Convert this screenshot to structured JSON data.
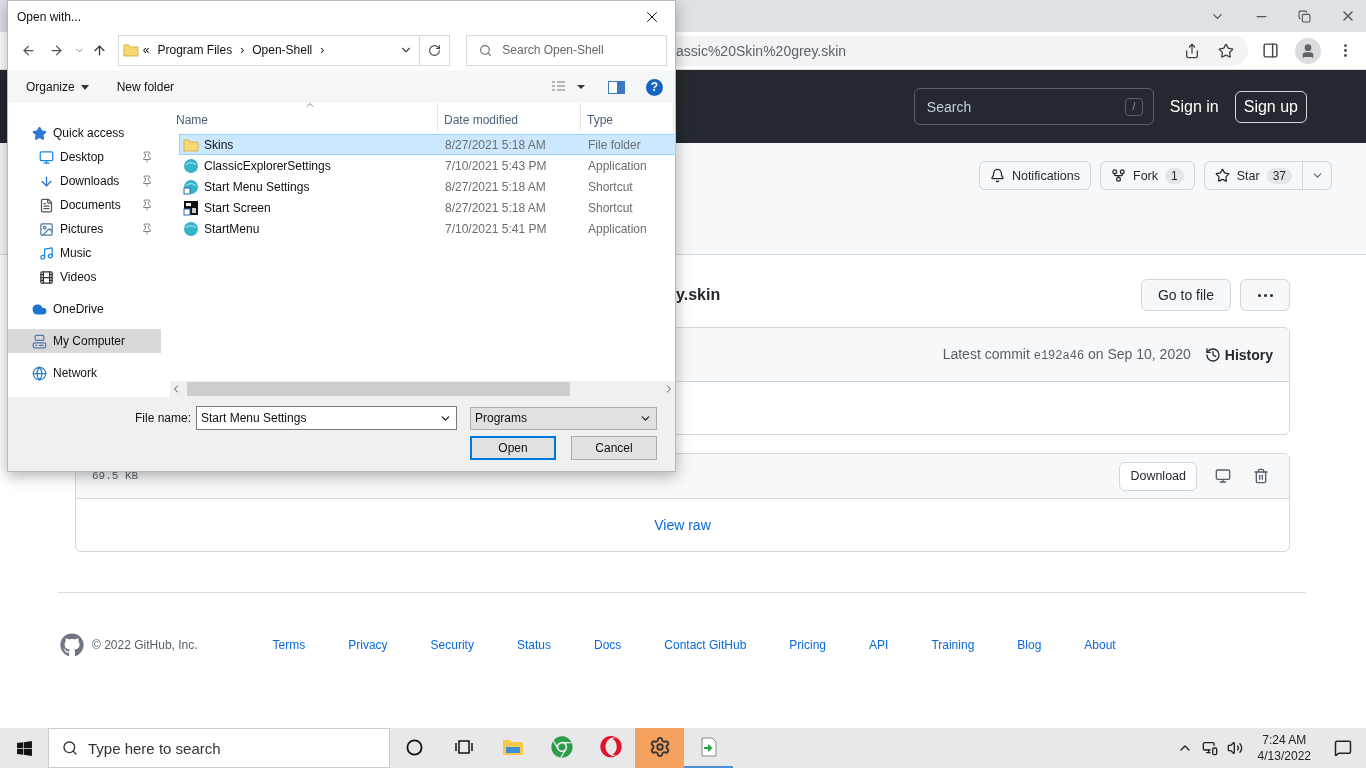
{
  "browser": {
    "url": "assic%20Skin%20grey.skin"
  },
  "github": {
    "search": {
      "placeholder": "Search",
      "shortcut": "/"
    },
    "sign_in": "Sign in",
    "sign_up": "Sign up",
    "repo_actions": [
      {
        "kind": "notifications",
        "label": "Notifications"
      },
      {
        "kind": "fork",
        "label": "Fork",
        "count": "1"
      },
      {
        "kind": "star",
        "label": "Star",
        "count": "37"
      }
    ],
    "file_title": "y.skin",
    "go_to_file": "Go to file",
    "commit": {
      "prefix": "Latest commit",
      "sha": "e192a46",
      "date": "on Sep 10, 2020"
    },
    "history": "History",
    "file_size": "69.5 KB",
    "download": "Download",
    "view_raw": "View raw",
    "footer": {
      "copyright": "© 2022 GitHub, Inc.",
      "links": [
        "Terms",
        "Privacy",
        "Security",
        "Status",
        "Docs",
        "Contact GitHub",
        "Pricing",
        "API",
        "Training",
        "Blog",
        "About"
      ]
    }
  },
  "dialog": {
    "title": "Open with...",
    "breadcrumbs": {
      "overflow": "«",
      "items": [
        {
          "label": "Program Files",
          "separator": "›"
        },
        {
          "label": "Open-Shell",
          "separator": "›"
        }
      ]
    },
    "search_placeholder": "Search Open-Shell",
    "help": "?",
    "commands": [
      {
        "label": "Organize",
        "menu": true
      },
      {
        "label": "New folder",
        "menu": false
      }
    ],
    "navigation": [
      {
        "label": "Quick access",
        "kind": "star",
        "selected": false,
        "pinned": false,
        "children": [
          {
            "label": "Desktop",
            "kind": "desktop",
            "selected": false,
            "pinned": true
          },
          {
            "label": "Downloads",
            "kind": "downloads",
            "selected": false,
            "pinned": true
          },
          {
            "label": "Documents",
            "kind": "documents",
            "selected": false,
            "pinned": true
          },
          {
            "label": "Pictures",
            "kind": "pictures",
            "selected": false,
            "pinned": true
          },
          {
            "label": "Music",
            "kind": "music",
            "selected": false,
            "pinned": false
          },
          {
            "label": "Videos",
            "kind": "videos",
            "selected": false,
            "pinned": false
          }
        ]
      },
      {
        "label": "OneDrive",
        "kind": "cloud",
        "selected": false,
        "pinned": false
      },
      {
        "label": "My Computer",
        "kind": "computer",
        "selected": true,
        "pinned": false
      },
      {
        "label": "Network",
        "kind": "network",
        "selected": false,
        "pinned": false
      }
    ],
    "columns": [
      {
        "label": "Name",
        "sorted": true
      },
      {
        "label": "Date modified",
        "sorted": false
      },
      {
        "label": "Type",
        "sorted": false
      }
    ],
    "files": [
      {
        "name": "Skins",
        "date": "8/27/2021 5:18 AM",
        "type": "File folder",
        "kind": "folder",
        "selected": true
      },
      {
        "name": "ClassicExplorerSettings",
        "date": "7/10/2021 5:43 PM",
        "type": "Application",
        "kind": "app",
        "selected": false
      },
      {
        "name": "Start Menu Settings",
        "date": "8/27/2021 5:18 AM",
        "type": "Shortcut",
        "kind": "shortcut",
        "selected": false
      },
      {
        "name": "Start Screen",
        "date": "8/27/2021 5:18 AM",
        "type": "Shortcut",
        "kind": "screen",
        "selected": false
      },
      {
        "name": "StartMenu",
        "date": "7/10/2021 5:41 PM",
        "type": "Application",
        "kind": "app",
        "selected": false
      }
    ],
    "file_name_label": "File name:",
    "file_name": "Start Menu Settings",
    "filter": "Programs",
    "buttons": [
      {
        "label": "Open",
        "default": true
      },
      {
        "label": "Cancel",
        "default": false
      }
    ]
  },
  "taskbar": {
    "search_placeholder": "Type here to search",
    "apps": [
      {
        "kind": "explorer",
        "highlighted": false,
        "running": false
      },
      {
        "kind": "chrome",
        "highlighted": false,
        "running": false
      },
      {
        "kind": "opera",
        "highlighted": false,
        "running": false
      },
      {
        "kind": "settings",
        "highlighted": true,
        "running": false
      },
      {
        "kind": "launcher",
        "highlighted": false,
        "running": true
      }
    ],
    "time": "7:24 AM",
    "date": "4/13/2022"
  }
}
